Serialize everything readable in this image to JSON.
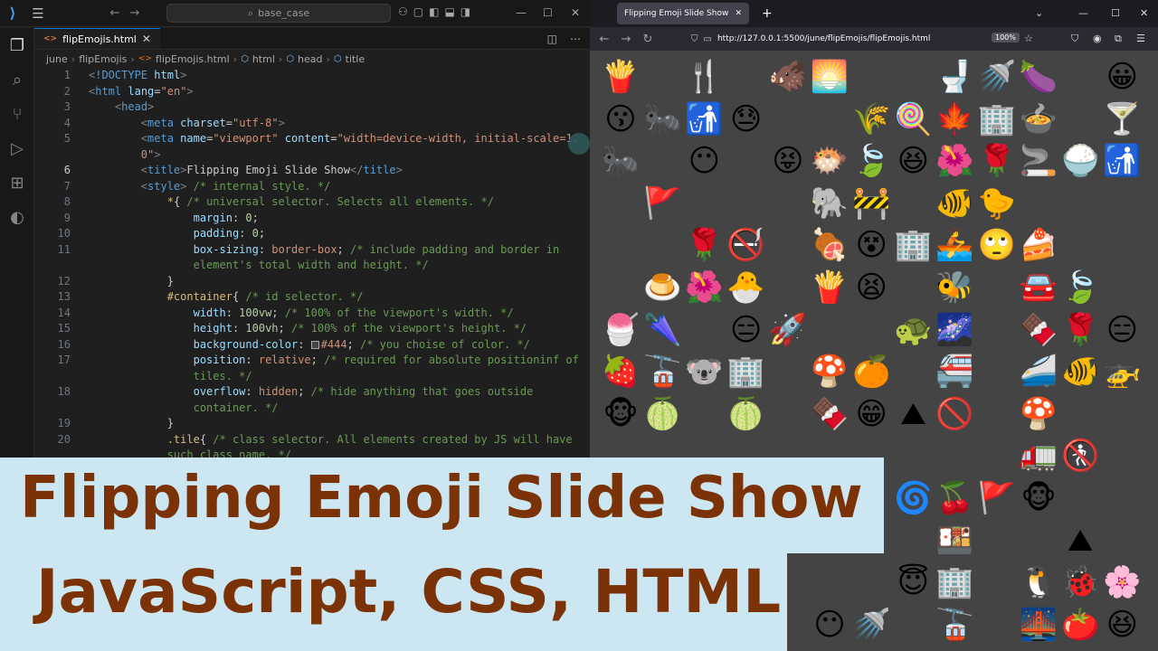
{
  "vscode": {
    "search": "base_case",
    "tab": {
      "label": "flipEmojis.html"
    },
    "breadcrumb": [
      "june",
      "flipEmojis",
      "flipEmojis.html",
      "html",
      "head",
      "title"
    ],
    "code": [
      {
        "n": "1",
        "html": "<span class='p'>&lt;</span><span class='t'>!DOCTYPE</span> <span class='a'>html</span><span class='p'>&gt;</span>"
      },
      {
        "n": "2",
        "html": "<span class='p'>&lt;</span><span class='t'>html</span> <span class='a'>lang</span>=<span class='s'>\"en\"</span><span class='p'>&gt;</span>"
      },
      {
        "n": "3",
        "html": "    <span class='p'>&lt;</span><span class='t'>head</span><span class='p'>&gt;</span>"
      },
      {
        "n": "4",
        "html": "        <span class='p'>&lt;</span><span class='t'>meta</span> <span class='a'>charset</span>=<span class='s'>\"utf-8\"</span><span class='p'>&gt;</span>"
      },
      {
        "n": "5",
        "html": "        <span class='p'>&lt;</span><span class='t'>meta</span> <span class='a'>name</span>=<span class='s'>\"viewport\"</span> <span class='a'>content</span>=<span class='s'>\"width=device-width, initial-scale=1.</span>"
      },
      {
        "n": "",
        "html": "        <span class='s'>0\"</span><span class='p'>&gt;</span>"
      },
      {
        "n": "6",
        "cur": true,
        "html": "        <span class='p'>&lt;</span><span class='t'>title</span><span class='p'>&gt;</span>Flipping Emoji Slide Show<span class='p'>&lt;/</span><span class='t'>title</span><span class='p'>&gt;</span>"
      },
      {
        "n": "7",
        "html": "        <span class='p'>&lt;</span><span class='t'>style</span><span class='p'>&gt;</span> <span class='c'>/* internal style. */</span>"
      },
      {
        "n": "8",
        "html": "            <span class='sel'>*</span>{ <span class='c'>/* universal selector. Selects all elements. */</span>"
      },
      {
        "n": "9",
        "html": "                <span class='pr'>margin</span>: <span class='v'>0</span>;"
      },
      {
        "n": "10",
        "html": "                <span class='pr'>padding</span>: <span class='v'>0</span>;"
      },
      {
        "n": "11",
        "html": "                <span class='pr'>box-sizing</span>: <span class='kw'>border-box</span>; <span class='c'>/* include padding and border in</span>"
      },
      {
        "n": "",
        "html": "                <span class='c'>element's total width and height. */</span>"
      },
      {
        "n": "12",
        "html": "            }"
      },
      {
        "n": "13",
        "html": "            <span class='sel'>#container</span>{ <span class='c'>/* id selector. */</span>"
      },
      {
        "n": "14",
        "html": "                <span class='pr'>width</span>: <span class='v'>100vw</span>; <span class='c'>/* 100% of the viewport's width. */</span>"
      },
      {
        "n": "15",
        "html": "                <span class='pr'>height</span>: <span class='v'>100vh</span>; <span class='c'>/* 100% of the viewport's height. */</span>"
      },
      {
        "n": "16",
        "html": "                <span class='pr'>background-color</span>: <span class='swatch'></span><span class='kw'>#444</span>; <span class='c'>/* you choise of color. */</span>"
      },
      {
        "n": "17",
        "html": "                <span class='pr'>position</span>: <span class='kw'>relative</span>; <span class='c'>/* required for absolute positioninf of</span>"
      },
      {
        "n": "",
        "html": "                <span class='c'>tiles. */</span>"
      },
      {
        "n": "18",
        "html": "                <span class='pr'>overflow</span>: <span class='kw'>hidden</span>; <span class='c'>/* hide anything that goes outside</span>"
      },
      {
        "n": "",
        "html": "                <span class='c'>container. */</span>"
      },
      {
        "n": "19",
        "html": "            }"
      },
      {
        "n": "20",
        "html": "            <span class='sel'>.tile</span>{ <span class='c'>/* class selector. All elements created by JS will have</span>"
      },
      {
        "n": "",
        "html": "            <span class='c'>such class name. */</span>"
      }
    ]
  },
  "browser": {
    "tab_title": "Flipping Emoji Slide Show",
    "url": "http://127.0.0.1:5500/june/flipEmojis/flipEmojis.html",
    "zoom": "100%",
    "emojis": [
      {
        "e": "🍟",
        "c": 0,
        "r": 0
      },
      {
        "e": "🍴",
        "c": 2,
        "r": 0
      },
      {
        "e": "🐗",
        "c": 4,
        "r": 0
      },
      {
        "e": "🌅",
        "c": 5,
        "r": 0
      },
      {
        "e": "🚽",
        "c": 8,
        "r": 0
      },
      {
        "e": "🚿",
        "c": 9,
        "r": 0
      },
      {
        "e": "🍆",
        "c": 10,
        "r": 0
      },
      {
        "e": "😀",
        "c": 12,
        "r": 0
      },
      {
        "e": "😗",
        "c": 0,
        "r": 1
      },
      {
        "e": "🐜",
        "c": 1,
        "r": 1
      },
      {
        "e": "🚮",
        "c": 2,
        "r": 1
      },
      {
        "e": "😓",
        "c": 3,
        "r": 1
      },
      {
        "e": "🌾",
        "c": 6,
        "r": 1
      },
      {
        "e": "🍭",
        "c": 7,
        "r": 1
      },
      {
        "e": "🍁",
        "c": 8,
        "r": 1
      },
      {
        "e": "🏢",
        "c": 9,
        "r": 1
      },
      {
        "e": "🍲",
        "c": 10,
        "r": 1
      },
      {
        "e": "🍸",
        "c": 12,
        "r": 1
      },
      {
        "e": "🐜",
        "c": 0,
        "r": 2
      },
      {
        "e": "😶",
        "c": 2,
        "r": 2
      },
      {
        "e": "😝",
        "c": 4,
        "r": 2
      },
      {
        "e": "🐡",
        "c": 5,
        "r": 2
      },
      {
        "e": "🍃",
        "c": 6,
        "r": 2
      },
      {
        "e": "😆",
        "c": 7,
        "r": 2
      },
      {
        "e": "🌺",
        "c": 8,
        "r": 2
      },
      {
        "e": "🌹",
        "c": 9,
        "r": 2
      },
      {
        "e": "🚬",
        "c": 10,
        "r": 2
      },
      {
        "e": "🍚",
        "c": 11,
        "r": 2
      },
      {
        "e": "🚮",
        "c": 12,
        "r": 2
      },
      {
        "e": "🚩",
        "c": 1,
        "r": 3
      },
      {
        "e": "🐘",
        "c": 5,
        "r": 3
      },
      {
        "e": "🚧",
        "c": 6,
        "r": 3
      },
      {
        "e": "🐠",
        "c": 8,
        "r": 3
      },
      {
        "e": "🐤",
        "c": 9,
        "r": 3
      },
      {
        "e": "🌹",
        "c": 2,
        "r": 4
      },
      {
        "e": "🚭",
        "c": 3,
        "r": 4
      },
      {
        "e": "🍖",
        "c": 5,
        "r": 4
      },
      {
        "e": "😵",
        "c": 6,
        "r": 4
      },
      {
        "e": "🏢",
        "c": 7,
        "r": 4
      },
      {
        "e": "🚣",
        "c": 8,
        "r": 4
      },
      {
        "e": "🙄",
        "c": 9,
        "r": 4
      },
      {
        "e": "🍰",
        "c": 10,
        "r": 4
      },
      {
        "e": "🍮",
        "c": 1,
        "r": 5
      },
      {
        "e": "🌺",
        "c": 2,
        "r": 5
      },
      {
        "e": "🐣",
        "c": 3,
        "r": 5
      },
      {
        "e": "🍟",
        "c": 5,
        "r": 5
      },
      {
        "e": "😫",
        "c": 6,
        "r": 5
      },
      {
        "e": "🐝",
        "c": 8,
        "r": 5
      },
      {
        "e": "🚘",
        "c": 10,
        "r": 5
      },
      {
        "e": "🍃",
        "c": 11,
        "r": 5
      },
      {
        "e": "🍧",
        "c": 0,
        "r": 6
      },
      {
        "e": "🌂",
        "c": 1,
        "r": 6
      },
      {
        "e": "😑",
        "c": 3,
        "r": 6
      },
      {
        "e": "🚀",
        "c": 4,
        "r": 6
      },
      {
        "e": "🐢",
        "c": 7,
        "r": 6
      },
      {
        "e": "🌌",
        "c": 8,
        "r": 6
      },
      {
        "e": "🍫",
        "c": 10,
        "r": 6
      },
      {
        "e": "🌹",
        "c": 11,
        "r": 6
      },
      {
        "e": "😑",
        "c": 12,
        "r": 6
      },
      {
        "e": "🍓",
        "c": 0,
        "r": 7
      },
      {
        "e": "🚡",
        "c": 1,
        "r": 7
      },
      {
        "e": "🐨",
        "c": 2,
        "r": 7
      },
      {
        "e": "🏢",
        "c": 3,
        "r": 7
      },
      {
        "e": "🍄",
        "c": 5,
        "r": 7
      },
      {
        "e": "🍊",
        "c": 6,
        "r": 7
      },
      {
        "e": "🚝",
        "c": 8,
        "r": 7
      },
      {
        "e": "🚄",
        "c": 10,
        "r": 7
      },
      {
        "e": "🐠",
        "c": 11,
        "r": 7
      },
      {
        "e": "🚁",
        "c": 12,
        "r": 7
      },
      {
        "e": "🐵",
        "c": 0,
        "r": 8
      },
      {
        "e": "🍈",
        "c": 1,
        "r": 8
      },
      {
        "e": "🍈",
        "c": 3,
        "r": 8
      },
      {
        "e": "🍫",
        "c": 5,
        "r": 8
      },
      {
        "e": "😁",
        "c": 6,
        "r": 8
      },
      {
        "e": "⛰",
        "c": 7,
        "r": 8
      },
      {
        "e": "🚫",
        "c": 8,
        "r": 8
      },
      {
        "e": "🍄",
        "c": 10,
        "r": 8
      },
      {
        "e": "🚛",
        "c": 10,
        "r": 9
      },
      {
        "e": "🚷",
        "c": 11,
        "r": 9
      },
      {
        "e": "🌀",
        "c": 7,
        "r": 10
      },
      {
        "e": "🍒",
        "c": 8,
        "r": 10
      },
      {
        "e": "🚩",
        "c": 9,
        "r": 10
      },
      {
        "e": "🐵",
        "c": 10,
        "r": 10
      },
      {
        "e": "⛰",
        "c": 11,
        "r": 11
      },
      {
        "e": "🍱",
        "c": 8,
        "r": 11
      },
      {
        "e": "😇",
        "c": 7,
        "r": 12
      },
      {
        "e": "🏢",
        "c": 8,
        "r": 12
      },
      {
        "e": "🐧",
        "c": 10,
        "r": 12
      },
      {
        "e": "🐞",
        "c": 11,
        "r": 12
      },
      {
        "e": "🌸",
        "c": 12,
        "r": 12
      },
      {
        "e": "😶",
        "c": 5,
        "r": 13
      },
      {
        "e": "🚿",
        "c": 6,
        "r": 13
      },
      {
        "e": "🚡",
        "c": 8,
        "r": 13
      },
      {
        "e": "🌉",
        "c": 10,
        "r": 13
      },
      {
        "e": "🍅",
        "c": 11,
        "r": 13
      },
      {
        "e": "😆",
        "c": 12,
        "r": 13
      }
    ]
  },
  "banner": {
    "line1": "Flipping Emoji Slide Show",
    "line2": "JavaScript, CSS, HTML"
  }
}
